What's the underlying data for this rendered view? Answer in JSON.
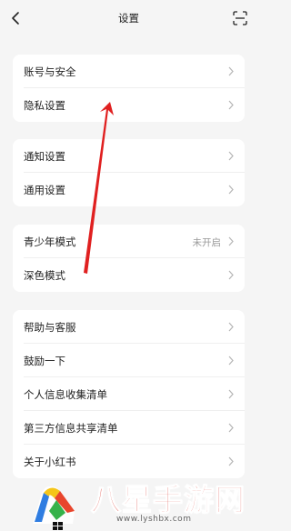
{
  "header": {
    "title": "设置",
    "back_icon": "chevron-left-icon",
    "scan_icon": "scan-icon"
  },
  "groups": [
    {
      "items": [
        {
          "label": "账号与安全"
        },
        {
          "label": "隐私设置"
        }
      ]
    },
    {
      "items": [
        {
          "label": "通知设置"
        },
        {
          "label": "通用设置"
        }
      ]
    },
    {
      "items": [
        {
          "label": "青少年模式",
          "value": "未开启"
        },
        {
          "label": "深色模式"
        }
      ]
    },
    {
      "items": [
        {
          "label": "帮助与客服"
        },
        {
          "label": "鼓励一下"
        },
        {
          "label": "个人信息收集清单"
        },
        {
          "label": "第三方信息共享清单"
        },
        {
          "label": "关于小红书"
        }
      ]
    }
  ],
  "watermark": {
    "text": "八星手游网",
    "url": "www.lyshbx.com"
  },
  "colors": {
    "background": "#f5f5f5",
    "card": "#ffffff",
    "annotation_arrow": "#e02020",
    "watermark_red": "#d93025"
  }
}
